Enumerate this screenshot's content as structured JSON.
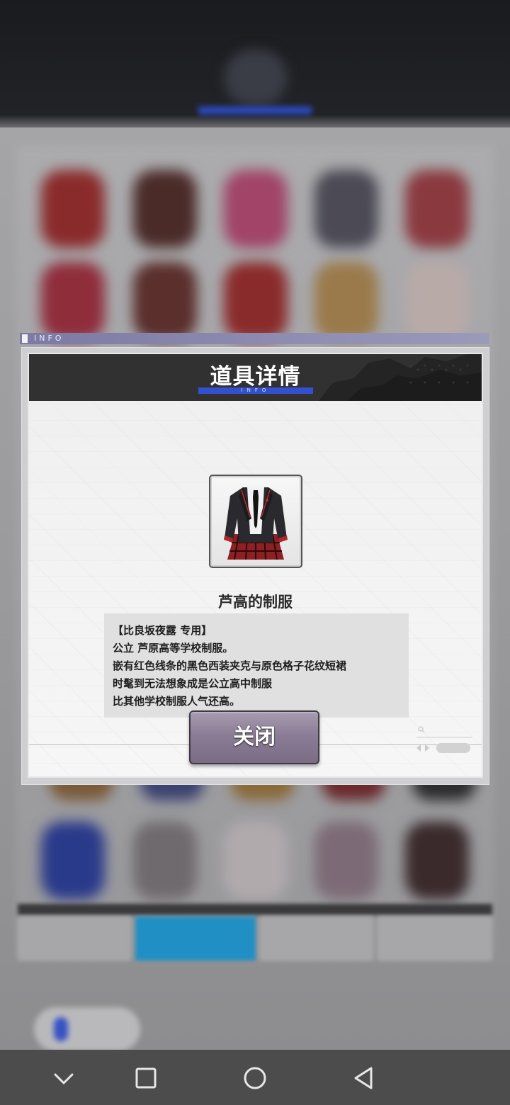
{
  "dialog": {
    "header_tag": "INFO",
    "title": "道具详情",
    "title_sub": "INFO",
    "item": {
      "name": "芦高的制服",
      "icon": "uniform-icon"
    },
    "description": [
      "【比良坂夜露 专用】",
      "公立 芦原高等学校制服。",
      "嵌有红色线条的黑色西装夹克与原色格子花纹短裙",
      "时髦到无法想象成是公立高中制服",
      "比其他学校制服人气还高。"
    ],
    "close_label": "关闭"
  },
  "navbar": {
    "buttons": [
      "chevron-down-icon",
      "recents-square-icon",
      "home-circle-icon",
      "back-triangle-icon"
    ]
  },
  "colors": {
    "accent_blue": "#3250d0",
    "header_dark": "#313131",
    "button_purple": "#8b7d95",
    "nav_bg": "#4c4c4c"
  }
}
